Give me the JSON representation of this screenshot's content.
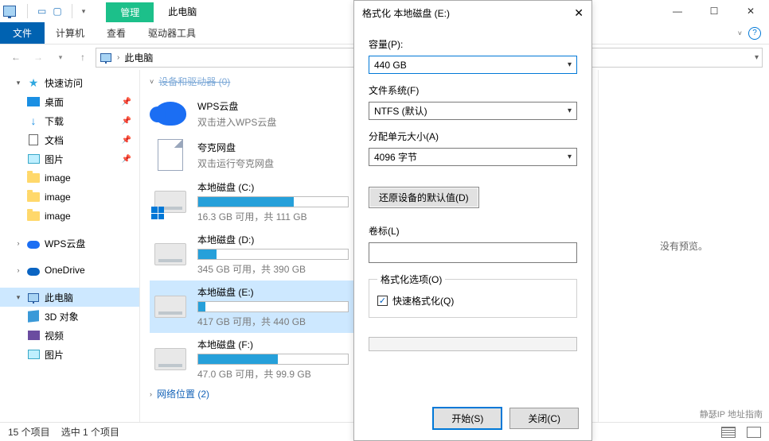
{
  "titlebar": {
    "context_tab": "管理",
    "title": "此电脑"
  },
  "window_controls": {
    "min": "—",
    "max": "☐",
    "close": "✕"
  },
  "ribbon": {
    "file": "文件",
    "items": [
      "计算机",
      "查看"
    ],
    "tools": "驱动器工具",
    "help": "?"
  },
  "addressbar": {
    "location": "此电脑"
  },
  "sidebar": {
    "quick": "快速访问",
    "quick_items": [
      {
        "label": "桌面",
        "pin": true
      },
      {
        "label": "下载",
        "pin": true
      },
      {
        "label": "文档",
        "pin": true
      },
      {
        "label": "图片",
        "pin": true
      },
      {
        "label": "image",
        "pin": false
      },
      {
        "label": "image",
        "pin": false
      },
      {
        "label": "image",
        "pin": false
      }
    ],
    "clouds": [
      {
        "label": "WPS云盘"
      },
      {
        "label": "OneDrive"
      }
    ],
    "this_pc": "此电脑",
    "pc_items": [
      "3D 对象",
      "视频",
      "图片"
    ]
  },
  "content": {
    "group0_label": "设备和驱动器 (0)",
    "wps": {
      "name": "WPS云盘",
      "sub": "双击进入WPS云盘"
    },
    "quark": {
      "name": "夸克网盘",
      "sub": "双击运行夸克网盘"
    },
    "drives": [
      {
        "name": "本地磁盘 (C:)",
        "used_pct": 64,
        "sub": "16.3 GB 可用，共 111 GB",
        "os": true
      },
      {
        "name": "本地磁盘 (D:)",
        "used_pct": 12,
        "sub": "345 GB 可用，共 390 GB",
        "os": false
      },
      {
        "name": "本地磁盘 (E:)",
        "used_pct": 5,
        "sub": "417 GB 可用，共 440 GB",
        "os": false,
        "selected": true
      },
      {
        "name": "本地磁盘 (F:)",
        "used_pct": 53,
        "sub": "47.0 GB 可用，共 99.9 GB",
        "os": false
      }
    ],
    "group1_label": "网络位置 (2)"
  },
  "preview": {
    "empty": "没有预览。"
  },
  "status": {
    "count": "15 个项目",
    "sel": "选中 1 个项目"
  },
  "dialog": {
    "title": "格式化 本地磁盘 (E:)",
    "capacity_label": "容量(P):",
    "capacity": "440 GB",
    "fs_label": "文件系统(F)",
    "fs": "NTFS (默认)",
    "au_label": "分配单元大小(A)",
    "au": "4096 字节",
    "restore": "还原设备的默认值(D)",
    "vol_label": "卷标(L)",
    "volume": "",
    "opts_legend": "格式化选项(O)",
    "quick": "快速格式化(Q)",
    "start": "开始(S)",
    "close": "关闭(C)"
  },
  "footer_note": "静瑟IP 地址指南"
}
